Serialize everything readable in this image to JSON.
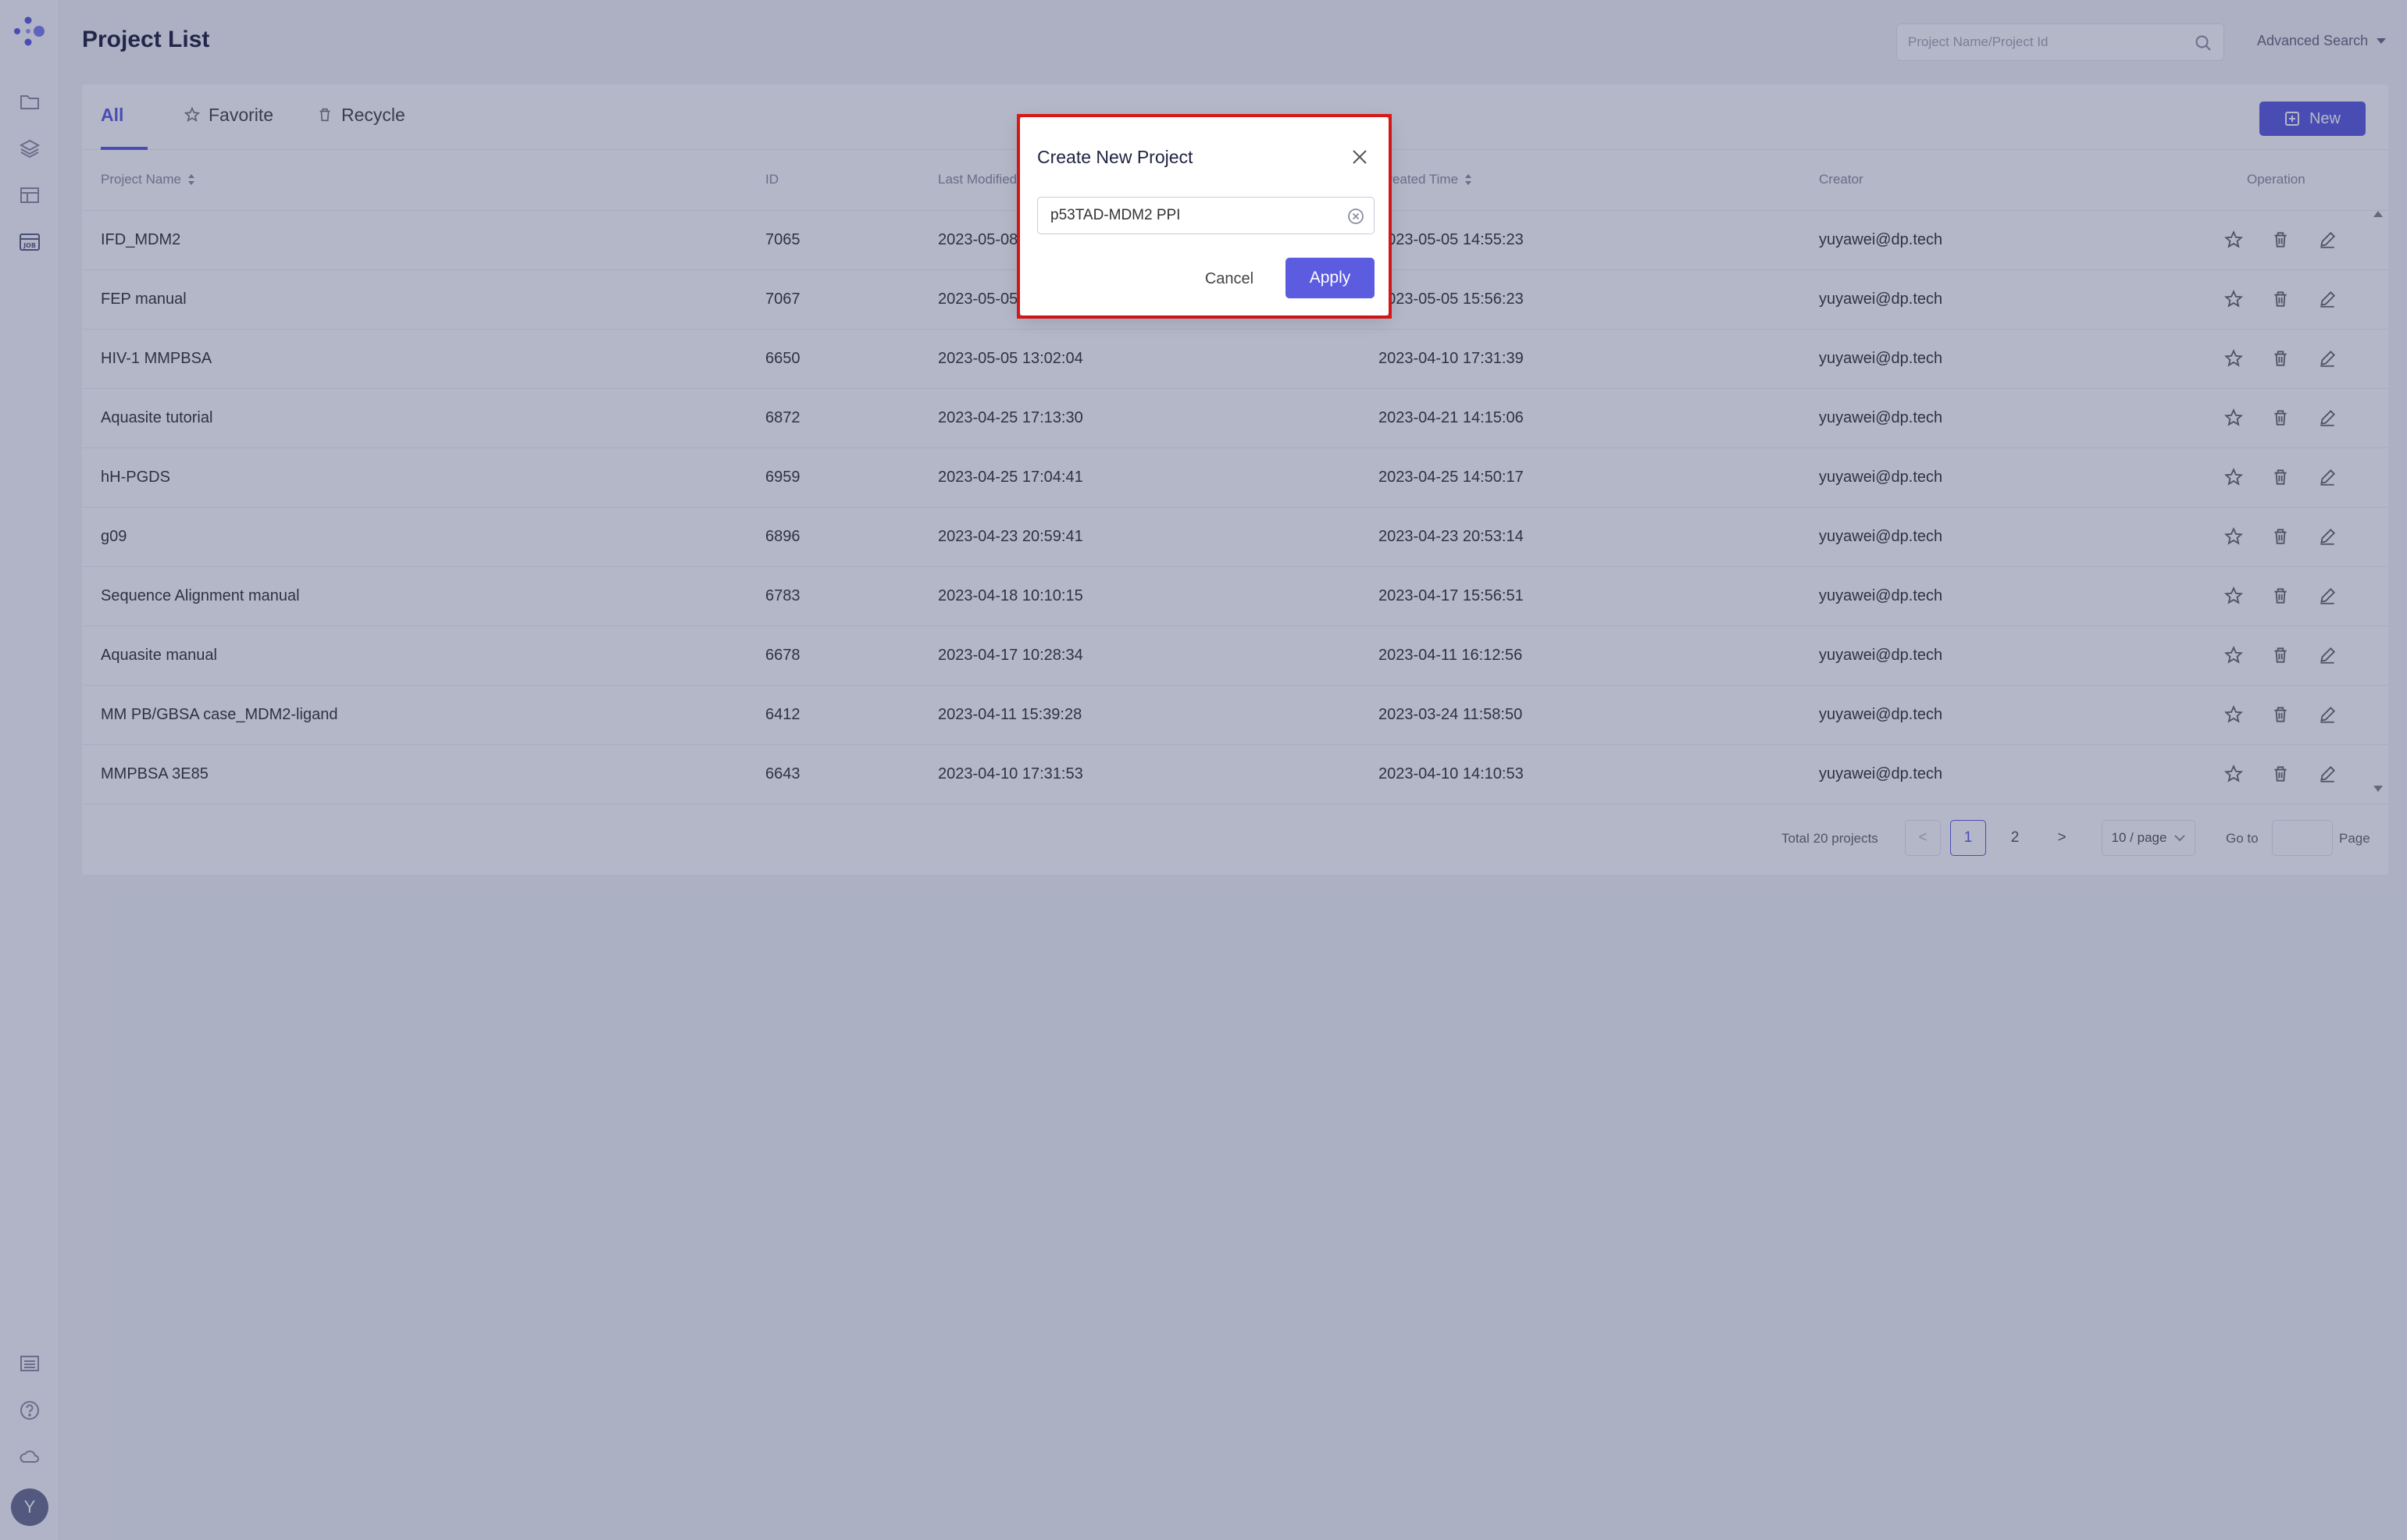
{
  "sidebar": {
    "logo_icon": "dots-logo-icon",
    "top_icons": [
      "folder-icon",
      "layers-icon",
      "table-icon",
      "job-icon"
    ],
    "job_label": "JOB",
    "bottom_icons": [
      "list-icon",
      "help-icon",
      "cloud-icon"
    ],
    "avatar_initial": "Y"
  },
  "header": {
    "title": "Project List",
    "search_placeholder": "Project Name/Project Id",
    "advanced_search": "Advanced Search"
  },
  "tabs": [
    {
      "label": "All",
      "active": true
    },
    {
      "label": "Favorite",
      "active": false
    },
    {
      "label": "Recycle",
      "active": false
    }
  ],
  "new_button": "New",
  "table": {
    "columns": [
      "Project Name",
      "ID",
      "Last Modified",
      "Created Time",
      "Creator",
      "Operation"
    ],
    "rows": [
      {
        "name": "IFD_MDM2",
        "id": "7065",
        "modified": "2023-05-08",
        "created": "2023-05-05 14:55:23",
        "creator": "yuyawei@dp.tech"
      },
      {
        "name": "FEP manual",
        "id": "7067",
        "modified": "2023-05-05",
        "created": "2023-05-05 15:56:23",
        "creator": "yuyawei@dp.tech"
      },
      {
        "name": "HIV-1 MMPBSA",
        "id": "6650",
        "modified": "2023-05-05 13:02:04",
        "created": "2023-04-10 17:31:39",
        "creator": "yuyawei@dp.tech"
      },
      {
        "name": "Aquasite tutorial",
        "id": "6872",
        "modified": "2023-04-25 17:13:30",
        "created": "2023-04-21 14:15:06",
        "creator": "yuyawei@dp.tech"
      },
      {
        "name": "hH-PGDS",
        "id": "6959",
        "modified": "2023-04-25 17:04:41",
        "created": "2023-04-25 14:50:17",
        "creator": "yuyawei@dp.tech"
      },
      {
        "name": "g09",
        "id": "6896",
        "modified": "2023-04-23 20:59:41",
        "created": "2023-04-23 20:53:14",
        "creator": "yuyawei@dp.tech"
      },
      {
        "name": "Sequence Alignment manual",
        "id": "6783",
        "modified": "2023-04-18 10:10:15",
        "created": "2023-04-17 15:56:51",
        "creator": "yuyawei@dp.tech"
      },
      {
        "name": "Aquasite manual",
        "id": "6678",
        "modified": "2023-04-17 10:28:34",
        "created": "2023-04-11 16:12:56",
        "creator": "yuyawei@dp.tech"
      },
      {
        "name": "MM PB/GBSA case_MDM2-ligand",
        "id": "6412",
        "modified": "2023-04-11 15:39:28",
        "created": "2023-03-24 11:58:50",
        "creator": "yuyawei@dp.tech"
      },
      {
        "name": "MMPBSA 3E85",
        "id": "6643",
        "modified": "2023-04-10 17:31:53",
        "created": "2023-04-10 14:10:53",
        "creator": "yuyawei@dp.tech"
      }
    ],
    "row_operations": [
      "star-icon",
      "trash-icon",
      "edit-icon"
    ]
  },
  "pagination": {
    "total": "Total 20 projects",
    "prev": "<",
    "pages": [
      "1",
      "2"
    ],
    "current": "1",
    "next": ">",
    "page_size": "10 / page",
    "goto_label": "Go to",
    "page_label": "Page"
  },
  "modal": {
    "title": "Create New Project",
    "input_value": "p53TAD-MDM2 PPI",
    "cancel": "Cancel",
    "apply": "Apply"
  },
  "colors": {
    "accent": "#5b5ce0",
    "highlight_outline": "#e01818",
    "overlay": "#28305f"
  }
}
